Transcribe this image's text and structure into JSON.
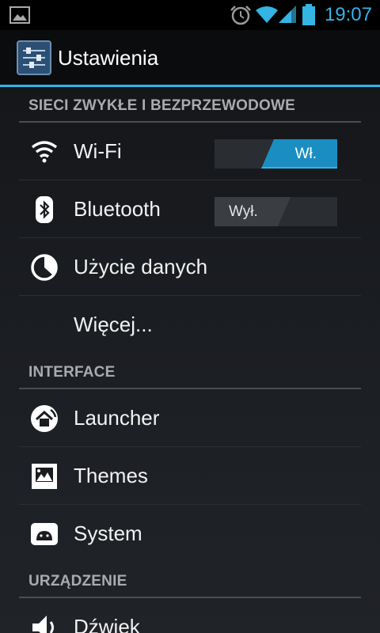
{
  "status_bar": {
    "time": "19:07",
    "icons": [
      "picture-notification-icon",
      "alarm-icon",
      "wifi-icon",
      "signal-icon",
      "battery-icon"
    ],
    "accent_color": "#33b5e5"
  },
  "action_bar": {
    "title": "Ustawienia",
    "icon": "settings-app-icon"
  },
  "sections": {
    "wireless": {
      "header": "SIECI ZWYKŁE I BEZPRZEWODOWE",
      "wifi": {
        "label": "Wi-Fi",
        "toggle": "Wł.",
        "state": "on",
        "icon": "wifi-icon"
      },
      "bluetooth": {
        "label": "Bluetooth",
        "toggle": "Wył.",
        "state": "off",
        "icon": "bluetooth-icon"
      },
      "data_usage": {
        "label": "Użycie danych",
        "icon": "data-usage-icon"
      },
      "more": {
        "label": "Więcej..."
      }
    },
    "interface": {
      "header": "INTERFACE",
      "launcher": {
        "label": "Launcher",
        "icon": "launcher-icon"
      },
      "themes": {
        "label": "Themes",
        "icon": "themes-icon"
      },
      "system": {
        "label": "System",
        "icon": "system-icon"
      }
    },
    "device": {
      "header": "URZĄDZENIE",
      "sound": {
        "label": "Dźwięk",
        "icon": "sound-icon"
      }
    }
  }
}
